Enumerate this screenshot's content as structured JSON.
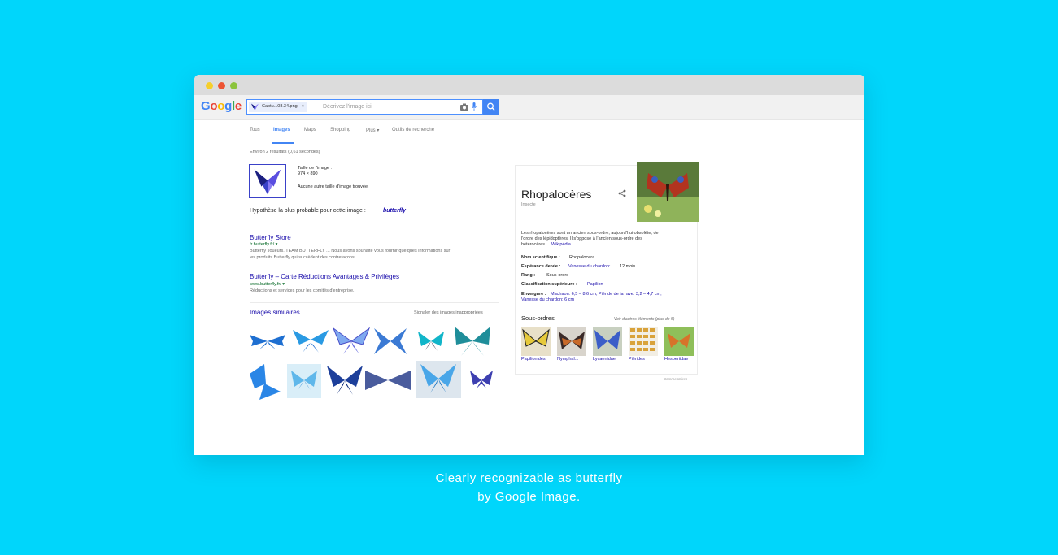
{
  "window": {
    "dots": [
      {
        "name": "minimize",
        "color": "#f6cf2a"
      },
      {
        "name": "close",
        "color": "#ed5333"
      },
      {
        "name": "maximize",
        "color": "#8cc43d"
      }
    ]
  },
  "logo": {
    "letters": [
      "G",
      "o",
      "o",
      "g",
      "l",
      "e"
    ],
    "colors": [
      "#4285f4",
      "#ea4335",
      "#fbbc05",
      "#4285f4",
      "#34a853",
      "#ea4335"
    ]
  },
  "search": {
    "chip_filename": "Captu...08.34.png",
    "chip_close": "×",
    "placeholder": "Décrivez l'image ici"
  },
  "tabs": [
    "Tous",
    "Images",
    "Maps",
    "Shopping",
    "Plus ▾",
    "Outils de recherche"
  ],
  "results": {
    "stats": "Environ 2 résultats (0,61 secondes)",
    "image_size_label": "Taille de l'image :",
    "image_size_value": "974 × 890",
    "no_other_size": "Aucune autre taille d'image trouvée.",
    "best_guess_prefix": "Hypothèse la plus probable pour cette image :",
    "best_guess_link": "butterfly",
    "items": [
      {
        "title": "Butterfly Store",
        "url": "fr.butterfly.fr/ ▾",
        "snippet1": "Butterfly Joueurs. TEAM BUTTERFLY ... Nous avons souhaité vous fournir quelques informations sur",
        "snippet2": "les produits Butterfly qui succèdent des contrefaçons."
      },
      {
        "title": "Butterfly – Carte Réductions Avantages & Privilèges",
        "url": "www.butterfly.fr/ ▾",
        "snippet1": "Réductions et services pour les comités d'entreprise."
      }
    ],
    "similar_title": "Images similaires",
    "report_link": "Signaler des images inappropriées"
  },
  "knowledge_panel": {
    "title": "Rhopalocères",
    "subtitle": "Insecte",
    "description1": "Les rhopalocères sont un ancien sous-ordre, aujourd'hui obsolète, de",
    "description2": "l'ordre des lépidoptères. Il s'oppose à l'ancien sous-ordre des",
    "description3": "hétérocères.",
    "wiki": "Wikipédia",
    "facts": [
      {
        "label": "Nom scientifique :",
        "value": "Rhopalocera",
        "link": ""
      },
      {
        "label": "Espérance de vie :",
        "value": "12 mois",
        "link": "Vanesse du chardon:"
      },
      {
        "label": "Rang :",
        "value": "Sous-ordre",
        "link": ""
      },
      {
        "label": "Classification supérieure :",
        "value": "",
        "link": "Papilion"
      },
      {
        "label": "Envergure :",
        "value": "",
        "link": "Machaon: 6,5 – 8,6 cm, Piéride de la rave: 3,2 – 4,7 cm,"
      }
    ],
    "envergure_line2": "Vanesse du chardon: 6 cm",
    "suborders_title": "Sous-ordres",
    "see_more": "Voir d'autres éléments (plus de 5)",
    "suborders": [
      "Papilionidés",
      "Nymphal...",
      "Lycaenidae",
      "Piérides",
      "Hesperiidae"
    ],
    "feedback": "Commentaires"
  },
  "caption": {
    "line1": "Clearly recognizable as butterfly",
    "line2": "by Google Image."
  },
  "icons": [
    "search-icon",
    "camera-icon",
    "microphone-icon",
    "share-icon",
    "butterfly-logo-icon"
  ]
}
